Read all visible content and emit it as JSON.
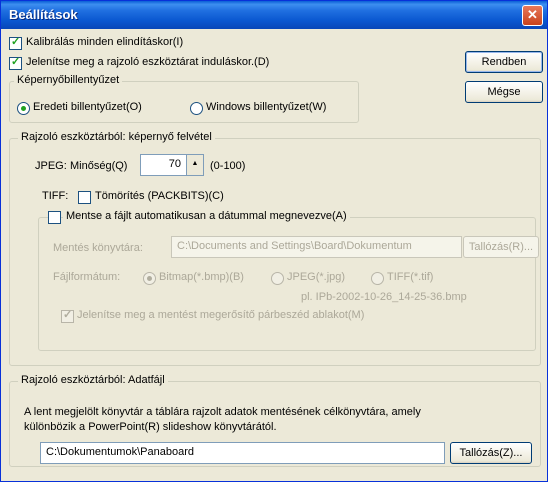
{
  "window": {
    "title": "Beállítások",
    "close_glyph": "✕"
  },
  "buttons": {
    "ok": "Rendben",
    "cancel": "Mégse"
  },
  "options": {
    "calibrate": "Kalibrálás minden elindításkor(I)",
    "show_toolbar": "Jelenítse meg a rajzoló eszköztárat induláskor.(D)"
  },
  "keyboard": {
    "legend": "Képernyőbillentyűzet",
    "original": "Eredeti billentyűzet(O)",
    "windows": "Windows billentyűzet(W)"
  },
  "capture": {
    "legend": "Rajzoló eszköztárból: képernyő felvétel",
    "jpeg_label": "JPEG:",
    "quality_label": "Minőség(Q)",
    "quality_value": "70",
    "quality_range": "(0-100)",
    "tiff_label": "TIFF:",
    "compress": "Tömörítés (PACKBITS)(C)",
    "autosave": "Mentse a fájlt automatikusan a dátummal megnevezve(A)",
    "save_dir_label": "Mentés könyvtára:",
    "save_dir_value": "C:\\Documents and Settings\\Board\\Dokumentum",
    "browse1": "Tallózás(R)...",
    "format_label": "Fájlformátum:",
    "fmt_bmp": "Bitmap(*.bmp)(B)",
    "fmt_jpg": "JPEG(*.jpg)",
    "fmt_tif": "TIFF(*.tif)",
    "example": "pl. IPb-2002-10-26_14-25-36.bmp",
    "confirm": "Jelenítse meg a mentést megerősítő párbeszéd ablakot(M)"
  },
  "datafile": {
    "legend": "Rajzoló eszköztárból: Adatfájl",
    "desc1": "A lent megjelölt könyvtár a táblára rajzolt adatok mentésének célkönyvtára, amely",
    "desc2": "különbözik a PowerPoint(R) slideshow könyvtárától.",
    "path_value": "C:\\Dokumentumok\\Panaboard",
    "browse2": "Tallózás(Z)..."
  }
}
